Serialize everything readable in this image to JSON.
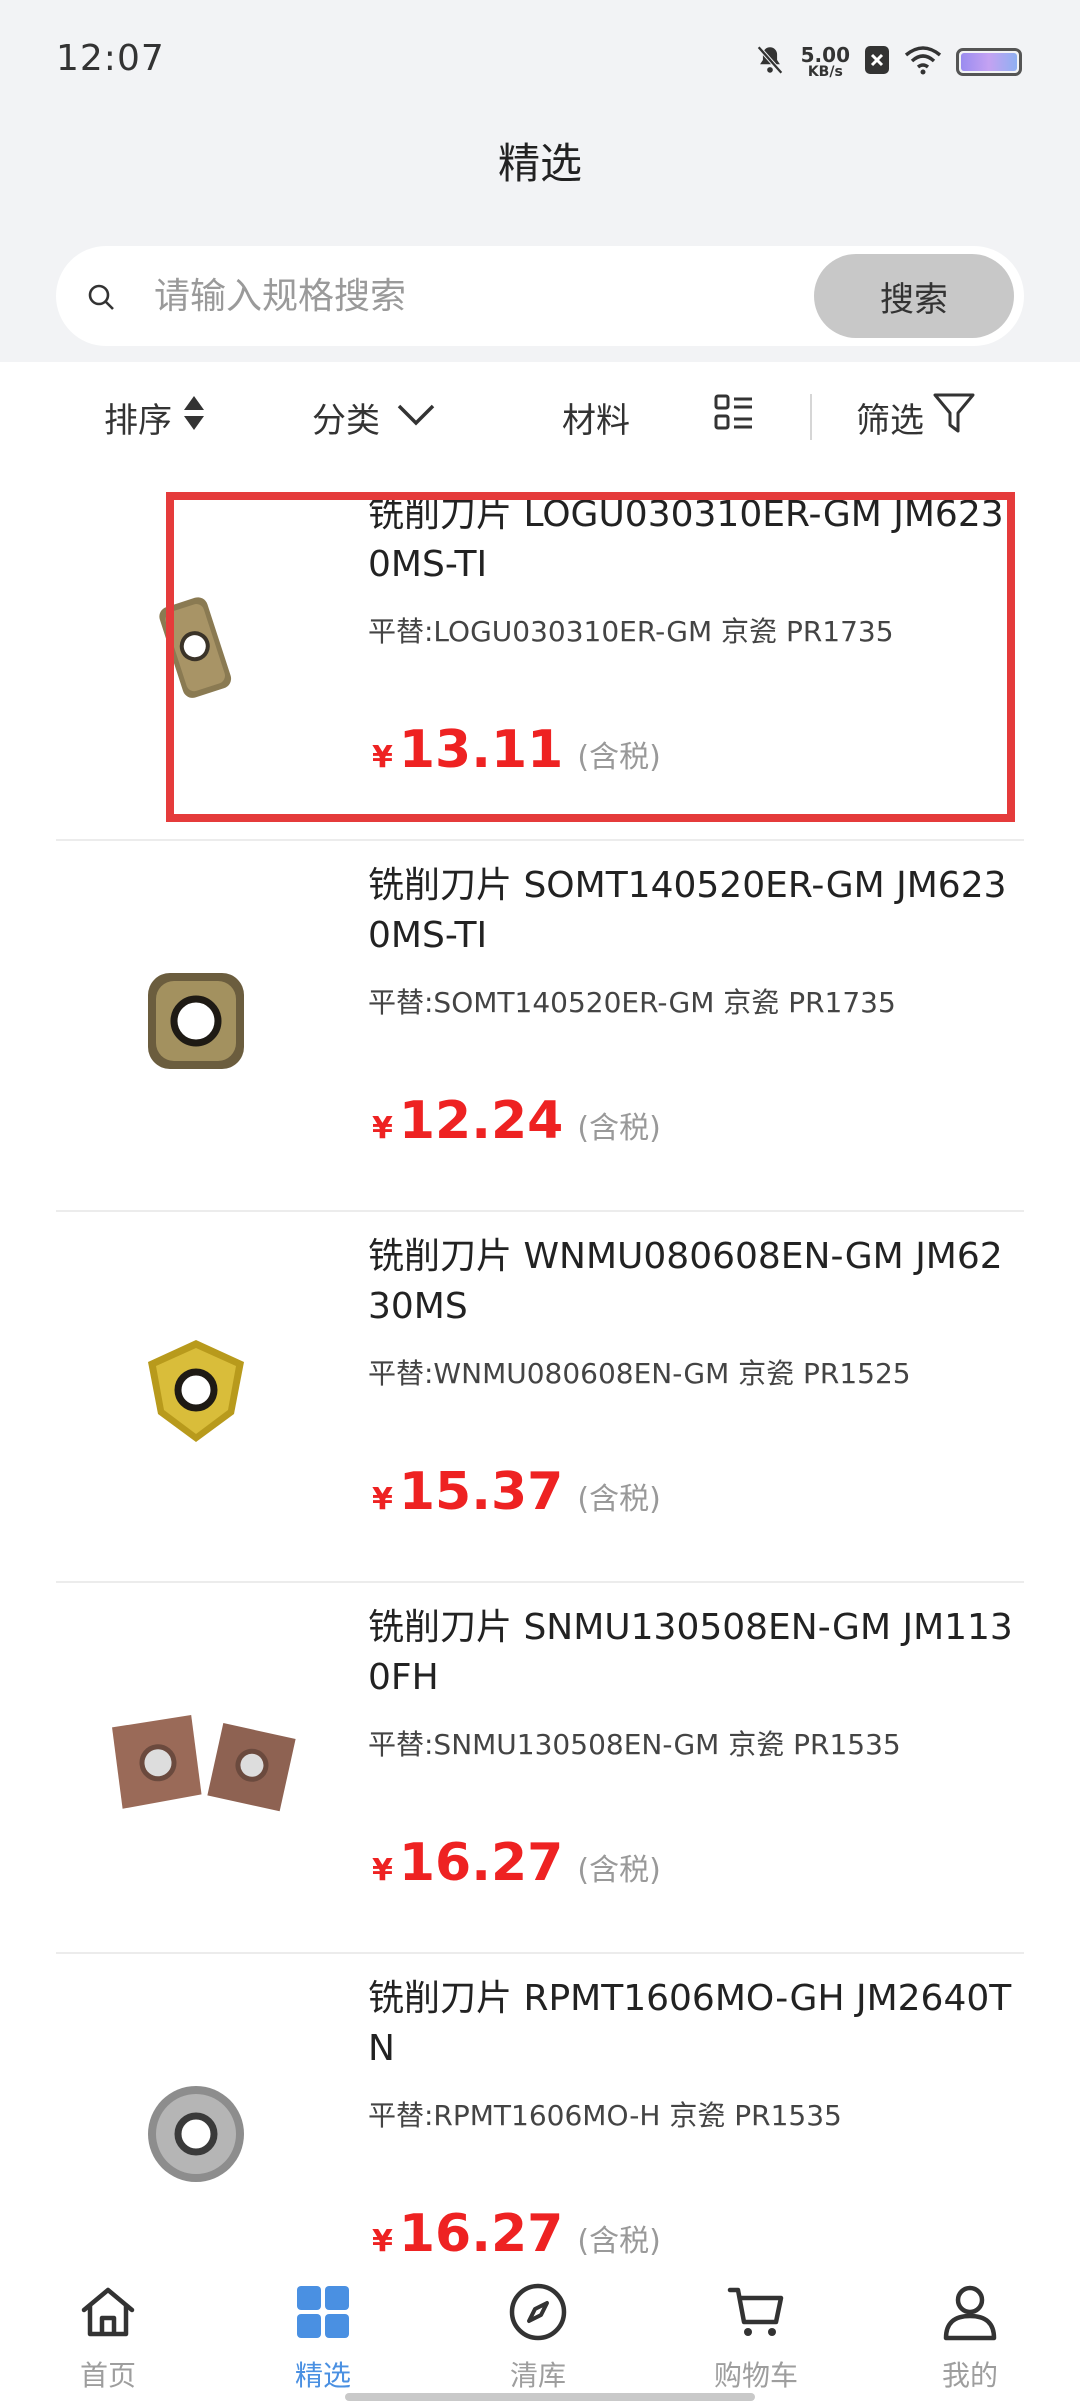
{
  "status": {
    "time": "12:07",
    "net_speed": "5.00",
    "net_unit": "KB/s"
  },
  "page": {
    "title": "精选"
  },
  "search": {
    "placeholder": "请输入规格搜索",
    "button": "搜索"
  },
  "filters": {
    "sort": "排序",
    "category": "分类",
    "material": "材料",
    "filter": "筛选"
  },
  "products": [
    {
      "title": "铣削刀片 LOGU030310ER-GM JM6230MS-TI",
      "alt": "平替:LOGU030310ER-GM 京瓷 PR1735",
      "currency": "¥",
      "price": "13.11",
      "tax": "(含税)"
    },
    {
      "title": "铣削刀片 SOMT140520ER-GM JM6230MS-TI",
      "alt": "平替:SOMT140520ER-GM 京瓷 PR1735",
      "currency": "¥",
      "price": "12.24",
      "tax": "(含税)"
    },
    {
      "title": "铣削刀片 WNMU080608EN-GM JM6230MS",
      "alt": "平替:WNMU080608EN-GM 京瓷 PR1525",
      "currency": "¥",
      "price": "15.37",
      "tax": "(含税)"
    },
    {
      "title": "铣削刀片 SNMU130508EN-GM JM1130FH",
      "alt": "平替:SNMU130508EN-GM 京瓷 PR1535",
      "currency": "¥",
      "price": "16.27",
      "tax": "(含税)"
    },
    {
      "title": "铣削刀片 RPMT1606MO-GH JM2640TN",
      "alt": "平替:RPMT1606MO-H 京瓷 PR1535",
      "currency": "¥",
      "price": "16.27",
      "tax": "(含税)"
    }
  ],
  "tabbar": {
    "home": "首页",
    "featured": "精选",
    "clearance": "清库",
    "cart": "购物车",
    "mine": "我的"
  },
  "colors": {
    "accent": "#4a90e2",
    "price": "#e22222",
    "highlight": "#e53b3b"
  }
}
